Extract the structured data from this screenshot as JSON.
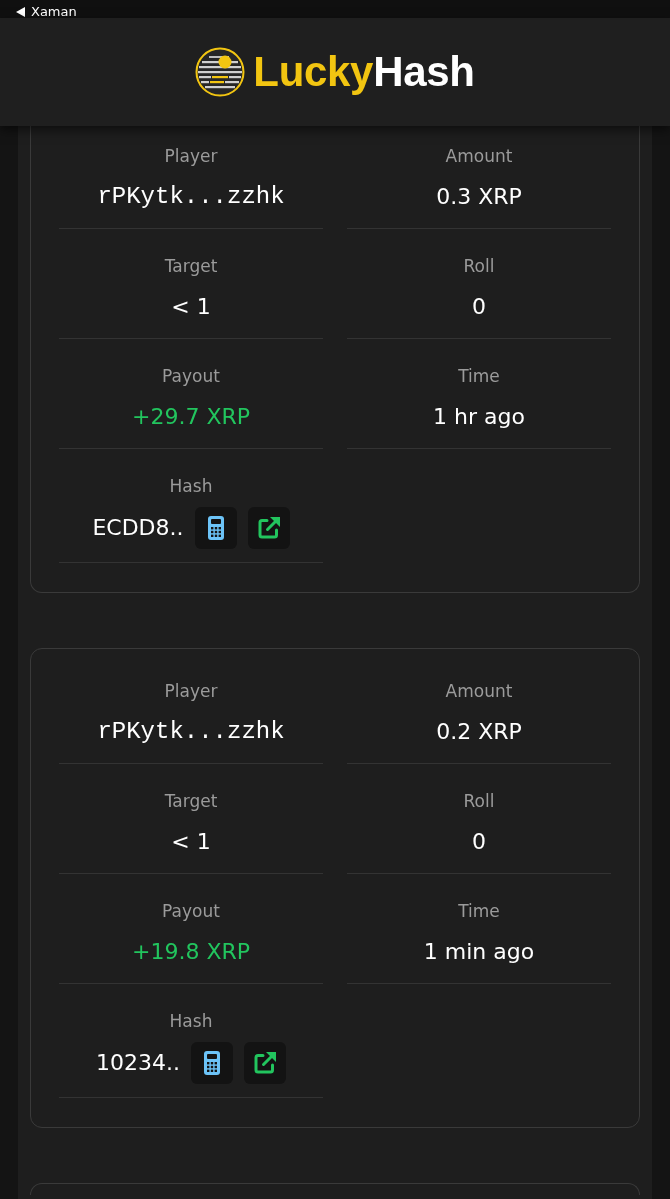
{
  "status_bar": {
    "back_label": "Xaman"
  },
  "header": {
    "brand": [
      {
        "text": "Lucky",
        "color": "#f2c511"
      },
      {
        "text": "Hash",
        "color": "#ffffff"
      }
    ]
  },
  "bets": [
    {
      "fields": [
        {
          "label": "Player",
          "value": "rPKytk...zzhk",
          "kind": "address"
        },
        {
          "label": "Amount",
          "value": "0.3 XRP",
          "kind": "plain"
        },
        {
          "label": "Target",
          "value": "< 1",
          "kind": "plain"
        },
        {
          "label": "Roll",
          "value": "0",
          "kind": "plain"
        },
        {
          "label": "Payout",
          "value": "+29.7 XRP",
          "kind": "win"
        },
        {
          "label": "Time",
          "value": "1 hr ago",
          "kind": "plain"
        },
        {
          "label": "Hash",
          "value": "ECDD8..",
          "kind": "hash"
        }
      ]
    },
    {
      "fields": [
        {
          "label": "Player",
          "value": "rPKytk...zzhk",
          "kind": "address"
        },
        {
          "label": "Amount",
          "value": "0.2 XRP",
          "kind": "plain"
        },
        {
          "label": "Target",
          "value": "< 1",
          "kind": "plain"
        },
        {
          "label": "Roll",
          "value": "0",
          "kind": "plain"
        },
        {
          "label": "Payout",
          "value": "+19.8 XRP",
          "kind": "win"
        },
        {
          "label": "Time",
          "value": "1 min ago",
          "kind": "plain"
        },
        {
          "label": "Hash",
          "value": "10234..",
          "kind": "hash"
        }
      ]
    }
  ]
}
